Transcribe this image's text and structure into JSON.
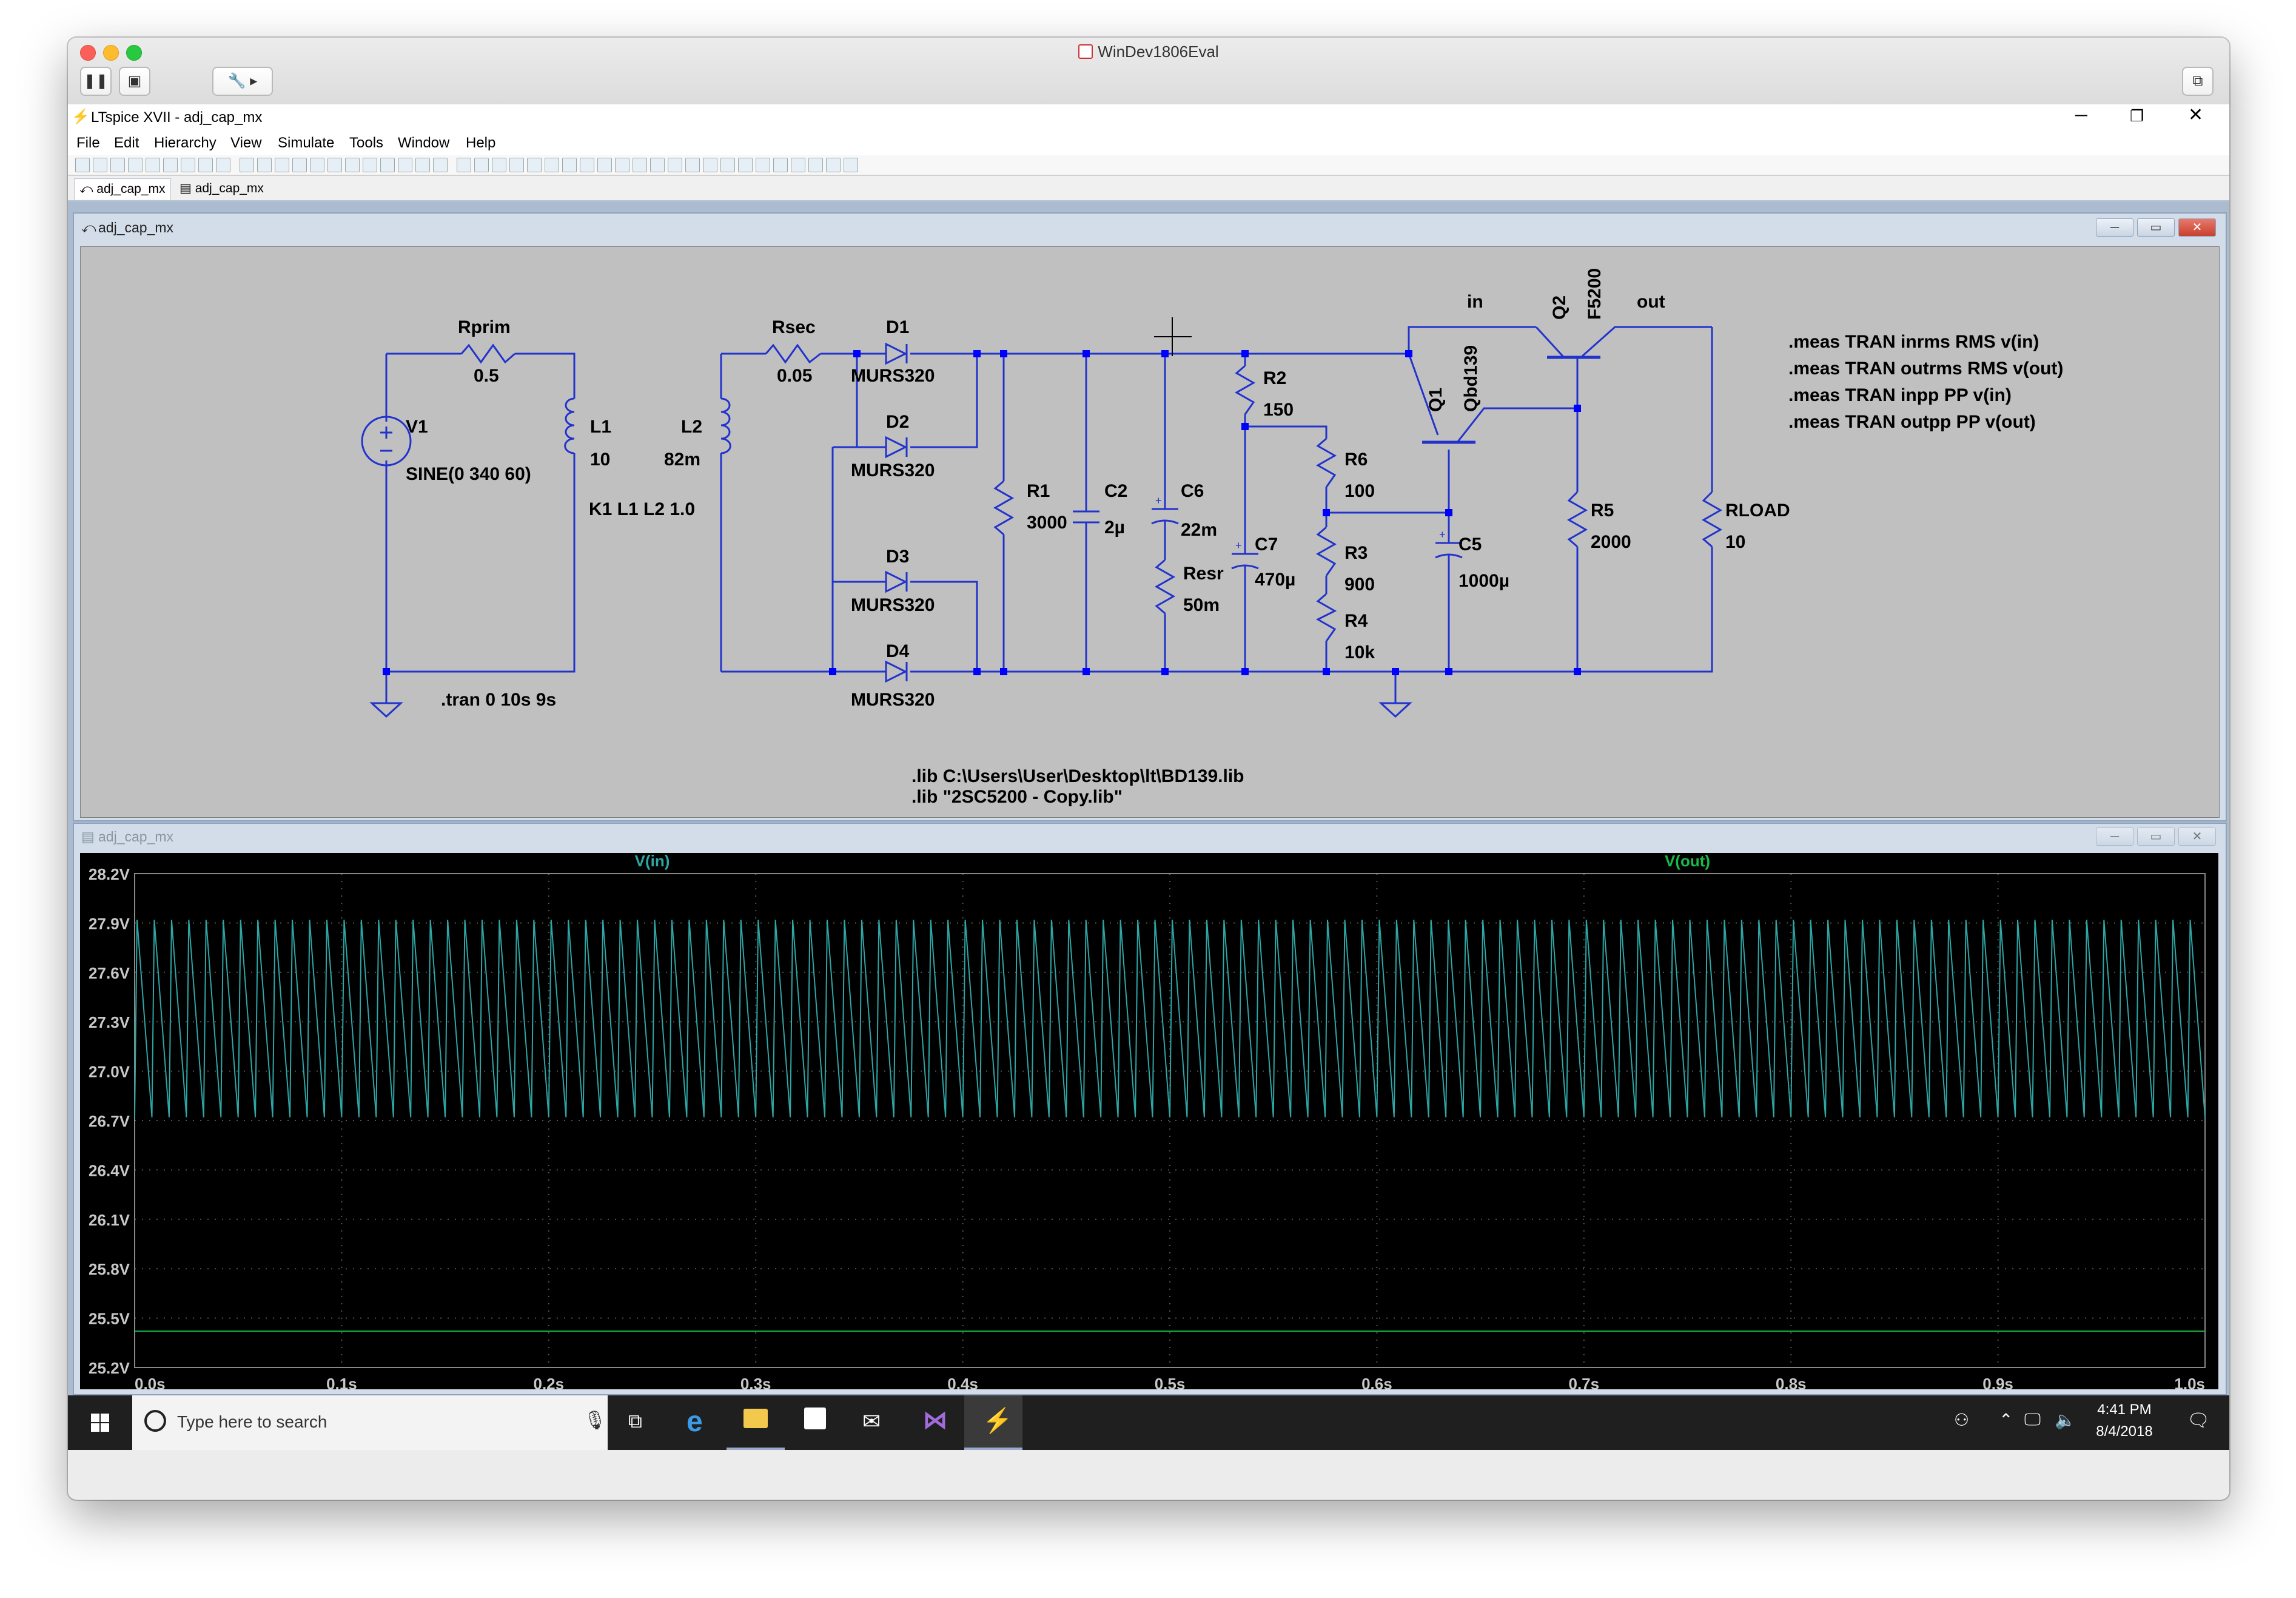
{
  "mac": {
    "title": "WinDev1806Eval"
  },
  "app": {
    "title": "LTspice XVII - adj_cap_mx",
    "menu": [
      "File",
      "Edit",
      "Hierarchy",
      "View",
      "Simulate",
      "Tools",
      "Window",
      "Help"
    ],
    "tabs": [
      "adj_cap_mx",
      "adj_cap_mx"
    ]
  },
  "schematic": {
    "window_title": "adj_cap_mx",
    "labels": {
      "rprim": "Rprim",
      "rprim_val": "0.5",
      "v1": "V1",
      "v1_val": "SINE(0 340 60)",
      "l1": "L1",
      "l1_val": "10",
      "l2": "L2",
      "l2_val": "82m",
      "k1": "K1 L1 L2 1.0",
      "tran": ".tran 0 10s 9s",
      "rsec": "Rsec",
      "rsec_val": "0.05",
      "d1": "D1",
      "d2": "D2",
      "d3": "D3",
      "d4": "D4",
      "diode_model": "MURS320",
      "r1": "R1",
      "r1_val": "3000",
      "c2": "C2",
      "c2_val": "2µ",
      "c6": "C6",
      "c6_val": "22m",
      "resr": "Resr",
      "resr_val": "50m",
      "r2": "R2",
      "r2_val": "150",
      "c7": "C7",
      "c7_val": "470µ",
      "r6": "R6",
      "r6_val": "100",
      "r3": "R3",
      "r3_val": "900",
      "r4": "R4",
      "r4_val": "10k",
      "q1": "Q1",
      "q1_model": "Qbd139",
      "q2": "Q2",
      "q2_model": "F5200",
      "c5": "C5",
      "c5_val": "1000µ",
      "r5": "R5",
      "r5_val": "2000",
      "rload": "RLOAD",
      "rload_val": "10",
      "net_in": "in",
      "net_out": "out",
      "meas1": ".meas TRAN inrms RMS v(in)",
      "meas2": ".meas TRAN outrms RMS v(out)",
      "meas3": ".meas TRAN inpp PP v(in)",
      "meas4": ".meas TRAN outpp PP v(out)",
      "lib1": ".lib C:\\Users\\User\\Desktop\\lt\\BD139.lib",
      "lib2": ".lib \"2SC5200 - Copy.lib\""
    }
  },
  "waveform": {
    "window_title": "adj_cap_mx"
  },
  "chart_data": {
    "type": "line",
    "x_ticks": [
      "0.0s",
      "0.1s",
      "0.2s",
      "0.3s",
      "0.4s",
      "0.5s",
      "0.6s",
      "0.7s",
      "0.8s",
      "0.9s",
      "1.0s"
    ],
    "y_ticks": [
      "28.2V",
      "27.9V",
      "27.6V",
      "27.3V",
      "27.0V",
      "26.7V",
      "26.4V",
      "26.1V",
      "25.8V",
      "25.5V",
      "25.2V"
    ],
    "xlim": [
      0,
      1.0
    ],
    "ylim": [
      25.2,
      28.2
    ],
    "grid": true,
    "series": [
      {
        "name": "V(in)",
        "color": "#2fa6a6",
        "shape": "sawtooth",
        "cycles": 120,
        "min": 26.72,
        "max": 27.92
      },
      {
        "name": "V(out)",
        "color": "#19b84a",
        "shape": "flat",
        "value": 25.42
      }
    ]
  },
  "taskbar": {
    "search_placeholder": "Type here to search",
    "time": "4:41 PM",
    "date": "8/4/2018"
  },
  "colors": {
    "wire": "#2233cc",
    "schematic_bg": "#c0c0c0",
    "plot_bg": "#000000"
  }
}
